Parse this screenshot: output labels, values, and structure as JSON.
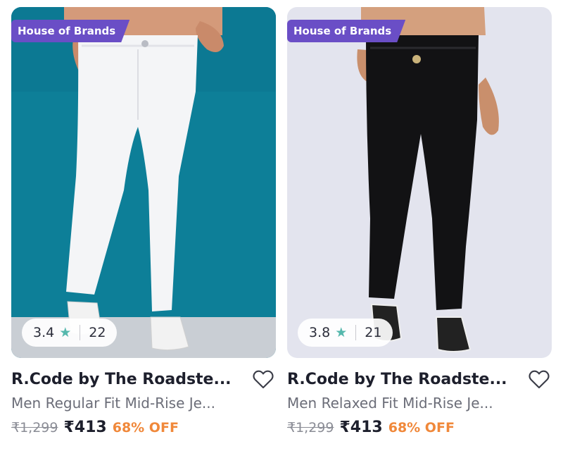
{
  "colors": {
    "badge": "#6a4ec6",
    "discount": "#f0883a",
    "star": "#55b8ad",
    "photo1_bg": "#0d7f98",
    "photo2_bg": "#e3e4ee"
  },
  "products": [
    {
      "badge": "House of Brands",
      "rating": "3.4",
      "star_icon": "★",
      "rating_count": "22",
      "title": "R.Code by The Roadste...",
      "subtitle": "Men Regular Fit Mid-Rise Je...",
      "mrp": "₹1,299",
      "price": "₹413",
      "discount": "68% OFF",
      "wishlist_icon": "heart-outline-icon"
    },
    {
      "badge": "House of Brands",
      "rating": "3.8",
      "star_icon": "★",
      "rating_count": "21",
      "title": "R.Code by The Roadste...",
      "subtitle": "Men Relaxed Fit Mid-Rise Je...",
      "mrp": "₹1,299",
      "price": "₹413",
      "discount": "68% OFF",
      "wishlist_icon": "heart-outline-icon"
    }
  ]
}
